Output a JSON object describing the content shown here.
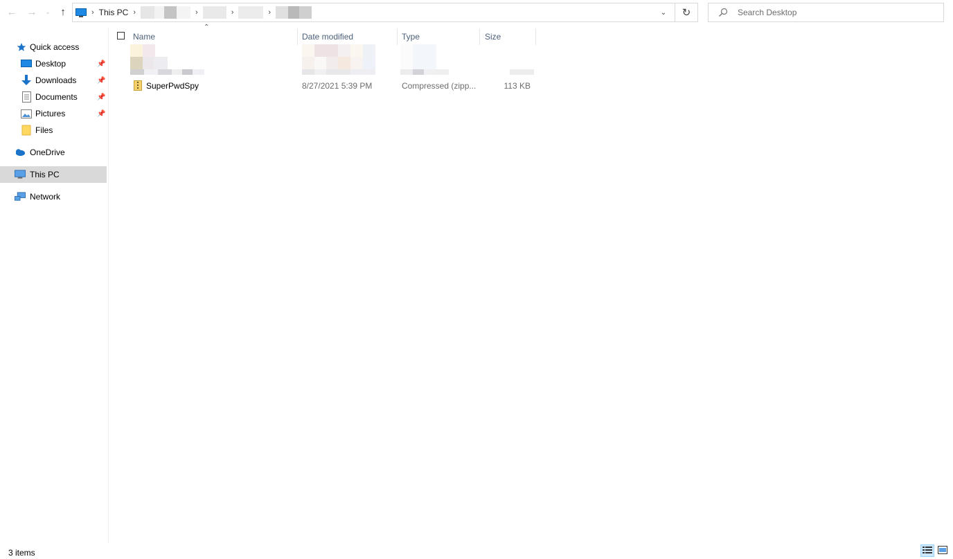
{
  "window": {
    "address": {
      "breadcrumbs": [
        "This PC"
      ],
      "search_placeholder": "Search Desktop"
    }
  },
  "nav_icons": {
    "back": "arrow-left-icon",
    "forward": "arrow-right-icon",
    "recent": "chevron-down-icon",
    "up": "arrow-up-icon"
  },
  "sidebar": {
    "items": [
      {
        "label": "Quick access",
        "icon": "star-icon",
        "pinned": false
      },
      {
        "label": "Desktop",
        "icon": "desktop-folder-icon",
        "pinned": true
      },
      {
        "label": "Downloads",
        "icon": "download-arrow-icon",
        "pinned": true
      },
      {
        "label": "Documents",
        "icon": "documents-icon",
        "pinned": true
      },
      {
        "label": "Pictures",
        "icon": "pictures-icon",
        "pinned": true
      },
      {
        "label": "Files",
        "icon": "folder-icon",
        "pinned": false
      },
      {
        "label": "OneDrive",
        "icon": "cloud-icon",
        "pinned": false
      },
      {
        "label": "This PC",
        "icon": "computer-icon",
        "pinned": false,
        "selected": true
      },
      {
        "label": "Network",
        "icon": "network-icon",
        "pinned": false
      }
    ]
  },
  "columns": {
    "name": "Name",
    "date_modified": "Date modified",
    "type": "Type",
    "size": "Size"
  },
  "files": [
    {
      "name": "SuperPwdSpy",
      "date_modified": "8/27/2021 5:39 PM",
      "type": "Compressed (zipp...",
      "size": "113 KB"
    }
  ],
  "status": {
    "item_count": "3 items"
  },
  "colors": {
    "selected_bg": "#d9d9d9",
    "header_text": "#4c607a",
    "accent": "#0078d7"
  }
}
